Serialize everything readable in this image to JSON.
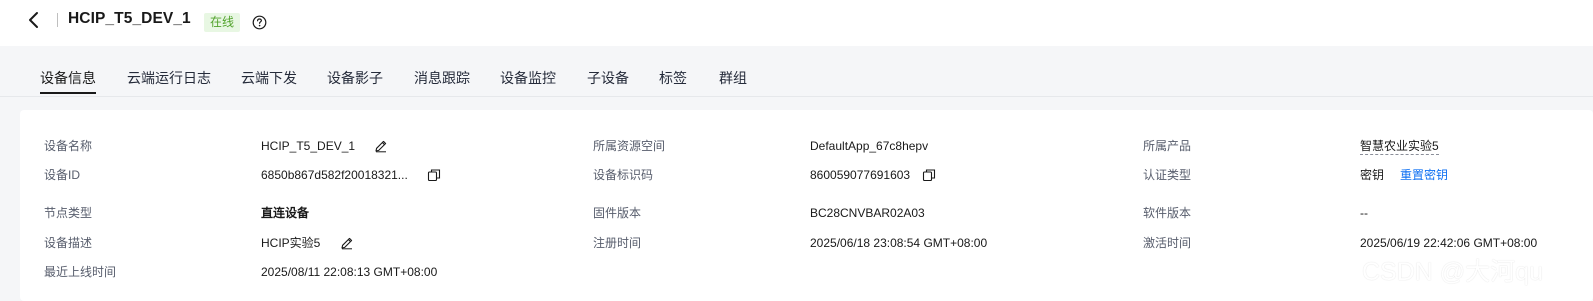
{
  "header": {
    "title": "HCIP_T5_DEV_1",
    "status": "在线",
    "colors": {
      "status_text": "#52a32c",
      "status_bg": "#e8f7e3"
    }
  },
  "tabs": [
    {
      "label": "设备信息",
      "active": true
    },
    {
      "label": "云端运行日志"
    },
    {
      "label": "云端下发"
    },
    {
      "label": "设备影子"
    },
    {
      "label": "消息跟踪"
    },
    {
      "label": "设备监控"
    },
    {
      "label": "子设备"
    },
    {
      "label": "标签"
    },
    {
      "label": "群组"
    }
  ],
  "info": {
    "device_name": {
      "label": "设备名称",
      "value": "HCIP_T5_DEV_1"
    },
    "device_id": {
      "label": "设备ID",
      "value": "6850b867d582f20018321..."
    },
    "node_type": {
      "label": "节点类型",
      "value": "直连设备"
    },
    "device_desc": {
      "label": "设备描述",
      "value": "HCIP实验5"
    },
    "last_online": {
      "label": "最近上线时间",
      "value": "2025/08/11 22:08:13 GMT+08:00"
    },
    "resource_space": {
      "label": "所属资源空间",
      "value": "DefaultApp_67c8hepv"
    },
    "node_id": {
      "label": "设备标识码",
      "value": "860059077691603"
    },
    "firmware": {
      "label": "固件版本",
      "value": "BC28CNVBAR02A03"
    },
    "registered": {
      "label": "注册时间",
      "value": "2025/06/18 23:08:54 GMT+08:00"
    },
    "product": {
      "label": "所属产品",
      "value": "智慧农业实验5"
    },
    "auth_type": {
      "label": "认证类型",
      "value": "密钥",
      "action": "重置密钥"
    },
    "software": {
      "label": "软件版本",
      "value": "--"
    },
    "activated": {
      "label": "激活时间",
      "value": "2025/06/19 22:42:06 GMT+08:00"
    }
  },
  "watermark": "CSDN @大河qu",
  "colors": {
    "link": "#0d6ff2",
    "page_bg": "#f5f6f8",
    "card_bg": "#ffffff"
  }
}
